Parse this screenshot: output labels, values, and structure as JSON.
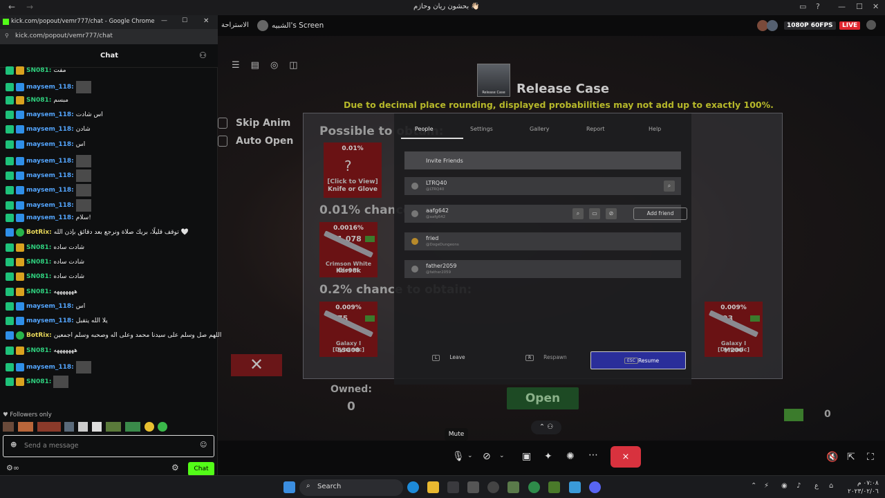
{
  "window_title": "بحشون ريان وحازم 👋🏻",
  "chat_window": {
    "title": "kick.com/popout/vemr777/chat - Google Chrome",
    "url": "kick.com/popout/vemr777/chat",
    "header": "Chat",
    "followers_only": "Followers only",
    "input_placeholder": "Send a message",
    "chat_button": "Chat",
    "messages": [
      {
        "user": "SN081:",
        "text": "مفت",
        "color": "#2fd07e",
        "badges": [
          "green",
          "gold"
        ]
      },
      {
        "user": "maysem_118:",
        "text": "",
        "color": "#54a6ff",
        "badges": [
          "green",
          "blue"
        ],
        "emote": true
      },
      {
        "user": "SN081:",
        "text": "مبسم",
        "color": "#2fd07e",
        "badges": [
          "green",
          "gold"
        ]
      },
      {
        "user": "maysem_118:",
        "text": "اس شادت",
        "color": "#54a6ff",
        "badges": [
          "green",
          "blue"
        ]
      },
      {
        "user": "maysem_118:",
        "text": "شادن",
        "color": "#54a6ff",
        "badges": [
          "green",
          "blue"
        ]
      },
      {
        "user": "maysem_118:",
        "text": "اس",
        "color": "#54a6ff",
        "badges": [
          "green",
          "blue"
        ]
      },
      {
        "user": "maysem_118:",
        "text": "",
        "color": "#54a6ff",
        "badges": [
          "green",
          "blue"
        ],
        "emote": true
      },
      {
        "user": "maysem_118:",
        "text": "",
        "color": "#54a6ff",
        "badges": [
          "green",
          "blue"
        ],
        "emote": true
      },
      {
        "user": "maysem_118:",
        "text": "",
        "color": "#54a6ff",
        "badges": [
          "green",
          "blue"
        ],
        "emote": true
      },
      {
        "user": "maysem_118:",
        "text": "",
        "color": "#54a6ff",
        "badges": [
          "green",
          "blue"
        ],
        "emote": true
      },
      {
        "user": "maysem_118:",
        "text": "سلام!",
        "color": "#54a6ff",
        "badges": [
          "green",
          "blue"
        ]
      },
      {
        "user": "BotRix:",
        "text": "توقف قليلًا، بريك صلاة ونرجع بعد دقائق بإذن الله 🤍",
        "color": "#e9d95a",
        "badges": [
          "blue",
          "check"
        ]
      },
      {
        "user": "SN081:",
        "text": "شادت ساده",
        "color": "#2fd07e",
        "badges": [
          "green",
          "gold"
        ]
      },
      {
        "user": "SN081:",
        "text": "شادت ساده",
        "color": "#2fd07e",
        "badges": [
          "green",
          "gold"
        ]
      },
      {
        "user": "SN081:",
        "text": "شادت ساده",
        "color": "#2fd07e",
        "badges": [
          "green",
          "gold"
        ]
      },
      {
        "user": "SN081:",
        "text": "هههههههه",
        "color": "#2fd07e",
        "badges": [
          "green",
          "gold"
        ]
      },
      {
        "user": "maysem_118:",
        "text": "اس",
        "color": "#54a6ff",
        "badges": [
          "green",
          "blue"
        ]
      },
      {
        "user": "maysem_118:",
        "text": "يلا الله يتقبل",
        "color": "#54a6ff",
        "badges": [
          "green",
          "blue"
        ]
      },
      {
        "user": "BotRix:",
        "text": "اللهم صل وسلم على سيدنا محمد وعلى اله وصحبه وسلم اجمعين",
        "color": "#e9d95a",
        "badges": [
          "blue",
          "check"
        ]
      },
      {
        "user": "SN081:",
        "text": "هههههههه",
        "color": "#2fd07e",
        "badges": [
          "green",
          "gold"
        ]
      },
      {
        "user": "maysem_118:",
        "text": "",
        "color": "#54a6ff",
        "badges": [
          "green",
          "blue"
        ],
        "emote": true
      },
      {
        "user": "SN081:",
        "text": "",
        "color": "#2fd07e",
        "badges": [
          "green",
          "gold"
        ],
        "emote": true
      }
    ]
  },
  "stream_header": {
    "breadcrumb": "الاستراحة",
    "screen_title": "الشبيه's Screen",
    "resolution": "1080P 60FPS",
    "live": "LIVE"
  },
  "game": {
    "case_image_label": "Release Case",
    "title": "Release Case",
    "disclaimer": "Due to decimal place rounding, displayed probabilities may not add up to exactly 100%.",
    "skip_anim": "Skip Anim",
    "auto_open": "Auto Open",
    "possible_to_obtain": "Possible to obtain:",
    "chance_001": "0.01% chance",
    "chance_02": "0.2% chance to obtain:",
    "mystery_card": {
      "pct": "0.01%",
      "line1": "[Click to View]",
      "line2": "Knife or Glove"
    },
    "row1_cards": [
      {
        "pct": "0.0016%",
        "num": "1,078",
        "name": "Crimson White Bloom",
        "weapon": "Kar98k"
      }
    ],
    "row2_cards": [
      {
        "pct": "0.009%",
        "num": "75",
        "name": "Galaxy I [Dynamic]",
        "weapon": "SSG08"
      },
      {
        "pct": "0.009%",
        "num": "93",
        "name": "Galaxy I [Dynamic]",
        "weapon": "M200"
      }
    ],
    "owned_label": "Owned:",
    "owned_value": "0",
    "open_button": "Open",
    "money_value": "0"
  },
  "overlay": {
    "tabs": [
      "People",
      "Settings",
      "Gallery",
      "Report",
      "Help"
    ],
    "invite": "Invite Friends",
    "people": [
      {
        "name": "LTRQ40",
        "handle": "@LTRQ40"
      },
      {
        "name": "aafg642",
        "handle": "@aafg642",
        "add_friend": "Add friend"
      },
      {
        "name": "fried",
        "handle": "@DogeDungeons"
      },
      {
        "name": "father2059",
        "handle": "@father2059"
      }
    ],
    "leave": "Leave",
    "leave_key": "L",
    "respawn": "Respawn",
    "respawn_key": "R",
    "resume": "Resume",
    "resume_key": "ESC"
  },
  "call": {
    "mute_tooltip": "Mute",
    "end_call_color": "#d8323e"
  },
  "taskbar": {
    "search": "Search",
    "time": "٠٧:٠٨ م",
    "date": "٢٠٢٣/٠٢/٠٦"
  }
}
